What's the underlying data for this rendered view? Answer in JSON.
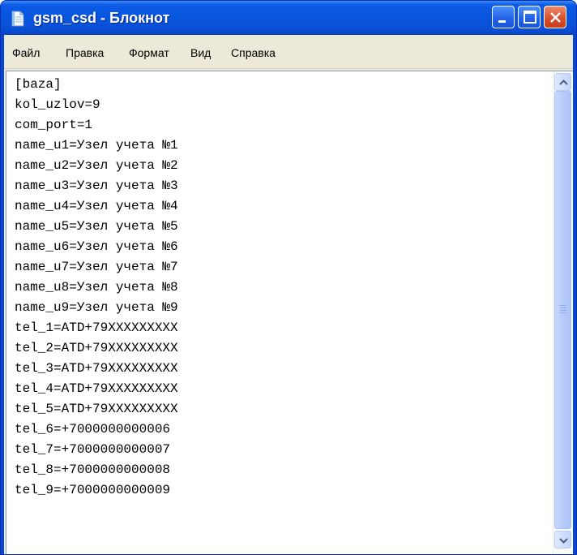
{
  "window": {
    "title": "gsm_csd - Блокнот"
  },
  "menu": {
    "items": [
      {
        "label": "Файл"
      },
      {
        "label": "Правка"
      },
      {
        "label": "Формат"
      },
      {
        "label": "Вид"
      },
      {
        "label": "Справка"
      }
    ]
  },
  "document": {
    "lines": [
      "[baza]",
      "kol_uzlov=9",
      "com_port=1",
      "name_u1=Узел учета №1",
      "name_u2=Узел учета №2",
      "name_u3=Узел учета №3",
      "name_u4=Узел учета №4",
      "name_u5=Узел учета №5",
      "name_u6=Узел учета №6",
      "name_u7=Узел учета №7",
      "name_u8=Узел учета №8",
      "name_u9=Узел учета №9",
      "tel_1=ATD+79XXXXXXXXX",
      "tel_2=ATD+79XXXXXXXXX",
      "tel_3=ATD+79XXXXXXXXX",
      "tel_4=ATD+79XXXXXXXXX",
      "tel_5=ATD+79XXXXXXXXX",
      "tel_6=+7000000000006",
      "tel_7=+7000000000007",
      "tel_8=+7000000000008",
      "tel_9=+7000000000009"
    ]
  },
  "icons": {
    "app": "notepad-icon",
    "minimize": "minimize-icon",
    "maximize": "maximize-icon",
    "close": "close-icon",
    "scroll_up": "chevron-up-icon",
    "scroll_down": "chevron-down-icon"
  },
  "colors": {
    "titlebar": "#0a52d9",
    "close_button": "#d8502c",
    "chrome": "#ece9d8"
  }
}
